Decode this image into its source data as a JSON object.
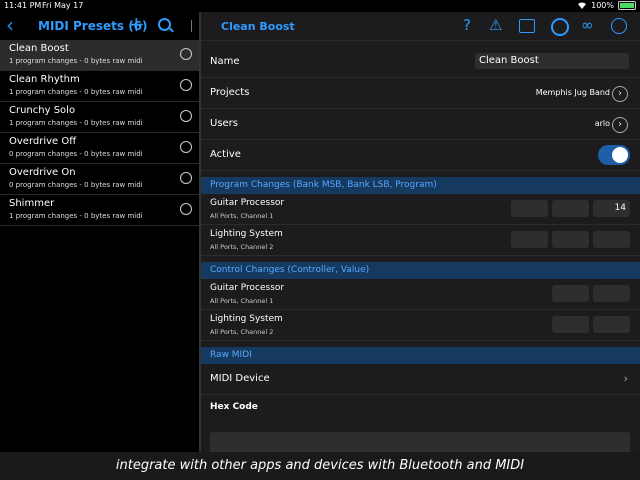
{
  "status": {
    "time": "11:41 PM",
    "date": "Fri May 17",
    "battery": "100%"
  },
  "left": {
    "back": "‹",
    "title": "MIDI Presets (6)",
    "presets": [
      {
        "name": "Clean Boost",
        "sub": "1 program changes - 0 bytes raw midi"
      },
      {
        "name": "Clean Rhythm",
        "sub": "1 program changes - 0 bytes raw midi"
      },
      {
        "name": "Crunchy Solo",
        "sub": "1 program changes - 0 bytes raw midi"
      },
      {
        "name": "Overdrive Off",
        "sub": "0 program changes - 0 bytes raw midi"
      },
      {
        "name": "Overdrive On",
        "sub": "0 program changes - 0 bytes raw midi"
      },
      {
        "name": "Shimmer",
        "sub": "1 program changes - 0 bytes raw midi"
      }
    ]
  },
  "detail": {
    "title": "Clean Boost",
    "name_label": "Name",
    "name_value": "Clean Boost",
    "projects_label": "Projects",
    "projects_value": "Memphis Jug Band",
    "users_label": "Users",
    "users_value": "arlo",
    "active_label": "Active",
    "active": true,
    "pc_section": "Program Changes (Bank MSB, Bank LSB, Program)",
    "pc_rows": [
      {
        "label": "Guitar Processor",
        "sub": "All Ports, Channel 1",
        "msb": "",
        "lsb": "",
        "program": "14"
      },
      {
        "label": "Lighting System",
        "sub": "All Ports, Channel 2",
        "msb": "",
        "lsb": "",
        "program": ""
      }
    ],
    "cc_section": "Control Changes (Controller, Value)",
    "cc_rows": [
      {
        "label": "Guitar Processor",
        "sub": "All Ports, Channel 1"
      },
      {
        "label": "Lighting System",
        "sub": "All Ports, Channel 2"
      }
    ],
    "raw_section": "Raw MIDI",
    "midi_device_label": "MIDI Device",
    "hex_label": "Hex Code"
  },
  "caption": "integrate with other apps and devices with Bluetooth and MIDI",
  "colors": {
    "accent": "#2f9bff",
    "section_bg": "#16395f",
    "toggle_on": "#1e5fa8"
  }
}
